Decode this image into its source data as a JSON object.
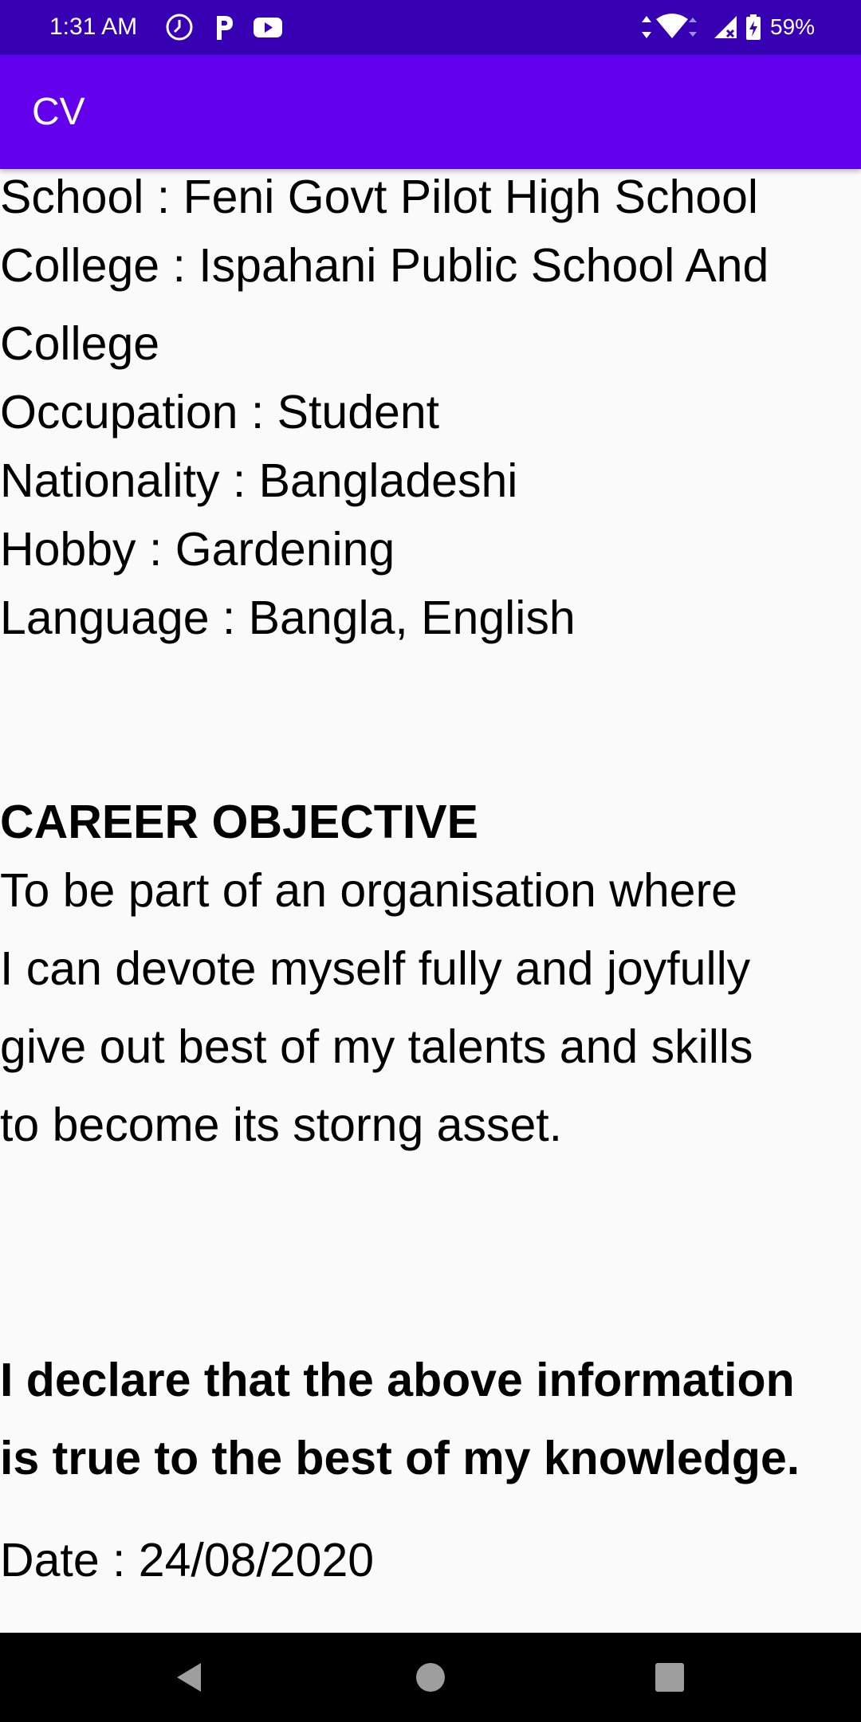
{
  "status_bar": {
    "time": "1:31 AM",
    "battery": "59%",
    "icons": [
      "alarm-icon",
      "p-app-icon",
      "youtube-icon",
      "data-arrows-icon",
      "wifi-icon",
      "signal-icon",
      "battery-icon"
    ],
    "background": "#3700b3"
  },
  "app_bar": {
    "title": "CV",
    "background": "#6200ee"
  },
  "cv": {
    "school": "School : Feni Govt Pilot High School",
    "college_line1": "College : Ispahani Public School And",
    "college_line2": "College",
    "occupation": "Occupation : Student",
    "nationality": "Nationality : Bangladeshi",
    "hobby": "Hobby : Gardening",
    "language": "Language : Bangla, English",
    "career_heading": "CAREER OBJECTIVE",
    "career_line1": "To be part of an organisation where",
    "career_line2": "I can devote myself fully and joyfully",
    "career_line3": "give out best of my talents and skills",
    "career_line4": "to become its storng asset.",
    "declaration_line1": "I declare that the above information",
    "declaration_line2": "is true to the best of my knowledge.",
    "date": "Date : 24/08/2020"
  },
  "nav_bar": {
    "buttons": [
      "back-icon",
      "home-icon",
      "recents-icon"
    ]
  }
}
